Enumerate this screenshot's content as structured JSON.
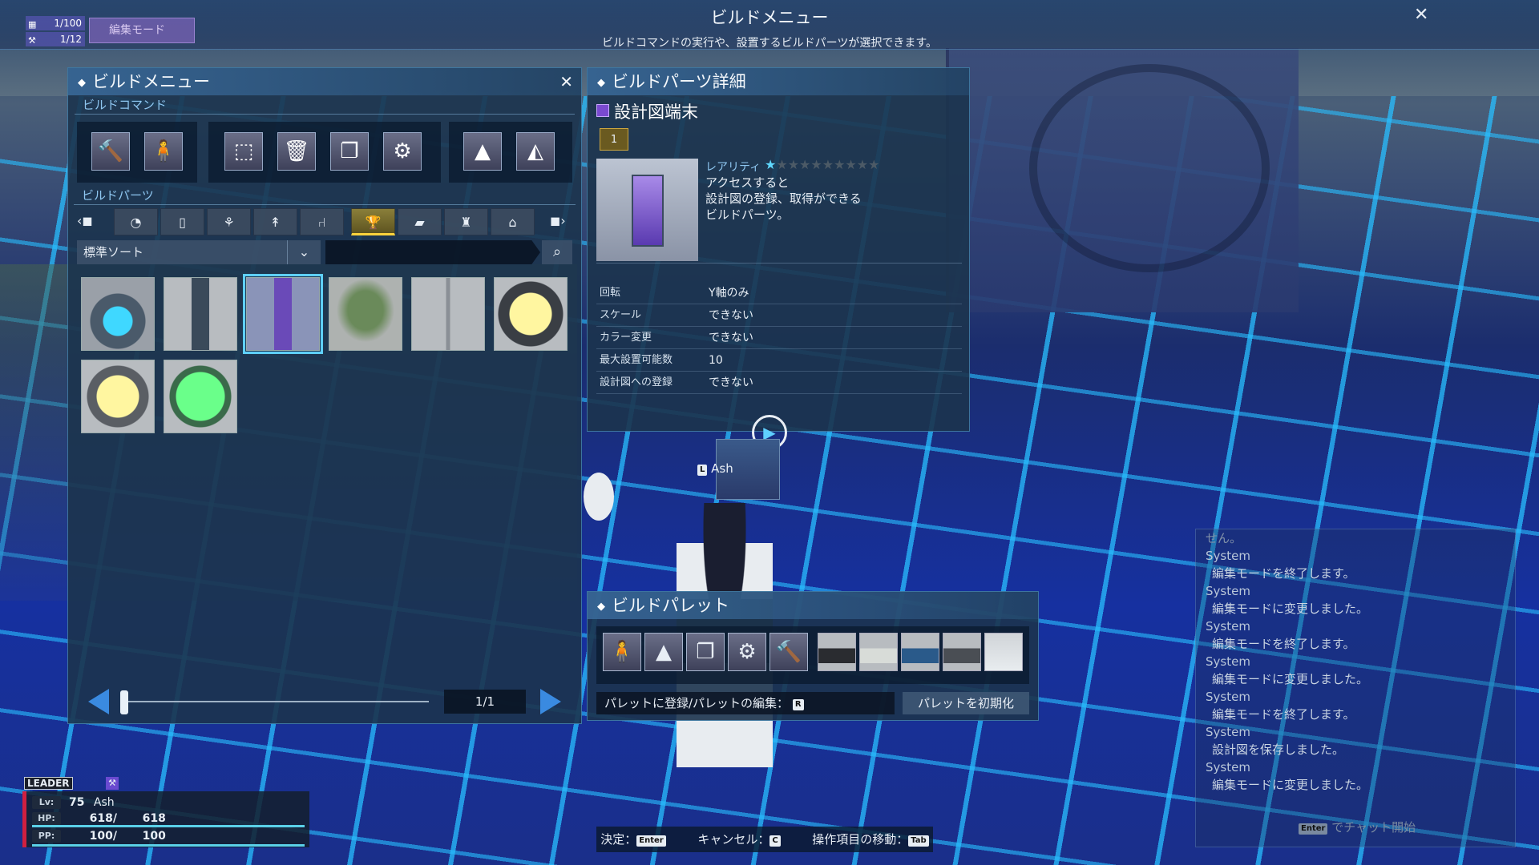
{
  "top": {
    "title": "ビルドメニュー",
    "subtitle": "ビルドコマンドの実行や、設置するビルドパーツが選択できます。",
    "counter1": "1/100",
    "counter2": "1/12",
    "edit_mode": "編集モード"
  },
  "menu": {
    "title": "ビルドメニュー",
    "commands_label": "ビルドコマンド",
    "parts_label": "ビルドパーツ",
    "sort": "標準ソート",
    "search_placeholder": "",
    "pager": "1/1",
    "commands": [
      "hammer-cancel-icon",
      "person-move-icon",
      "select-move-icon",
      "delete-icon",
      "copy-icon",
      "settings-icon",
      "raise-icon",
      "terrain-icon"
    ],
    "tabs": [
      "clock-icon",
      "door-icon",
      "planter-icon",
      "tree-icon",
      "chair-icon",
      "trophy-icon",
      "box-icon",
      "furniture-icon",
      "house-icon"
    ]
  },
  "detail": {
    "title": "ビルドパーツ詳細",
    "name": "設計図端末",
    "count": "1",
    "rarity_label": "レアリティ",
    "rarity": 1,
    "rarity_max": 10,
    "description": "アクセスすると\n設計図の登録、取得ができる\nビルドパーツ。",
    "props": [
      {
        "label": "回転",
        "value": "Y軸のみ"
      },
      {
        "label": "スケール",
        "value": "できない"
      },
      {
        "label": "カラー変更",
        "value": "できない"
      },
      {
        "label": "最大設置可能数",
        "value": "10"
      },
      {
        "label": "設計図への登録",
        "value": "できない"
      }
    ]
  },
  "palette": {
    "title": "ビルドパレット",
    "edit_label": "パレットに登録/パレットの編集：",
    "edit_key": "R",
    "reset": "パレットを初期化"
  },
  "player": {
    "tag_key": "L",
    "name": "Ash"
  },
  "chat": {
    "partial": "せん。",
    "lines": [
      {
        "sender": "System",
        "msg": "編集モードを終了します。"
      },
      {
        "sender": "System",
        "msg": "編集モードに変更しました。"
      },
      {
        "sender": "System",
        "msg": "編集モードを終了します。"
      },
      {
        "sender": "System",
        "msg": "編集モードに変更しました。"
      },
      {
        "sender": "System",
        "msg": "編集モードを終了します。"
      },
      {
        "sender": "System",
        "msg": "設計図を保存しました。"
      },
      {
        "sender": "System",
        "msg": "編集モードに変更しました。"
      }
    ],
    "hint_key": "Enter",
    "hint": "でチャット開始"
  },
  "status": {
    "leader": "LEADER",
    "lv_key": "Lv:",
    "lv": "75",
    "name": "Ash",
    "hp_key": "HP:",
    "hp": "618/",
    "hp_max": "618",
    "pp_key": "PP:",
    "pp": "100/",
    "pp_max": "100"
  },
  "help": {
    "confirm": "決定：",
    "confirm_key": "Enter",
    "cancel": "キャンセル：",
    "cancel_key": "C",
    "move": "操作項目の移動：",
    "move_key": "Tab"
  },
  "colors": {
    "accent": "#5fd0ff",
    "selected_tab": "#ffd23c",
    "edit_mode": "#9a6ed2"
  }
}
